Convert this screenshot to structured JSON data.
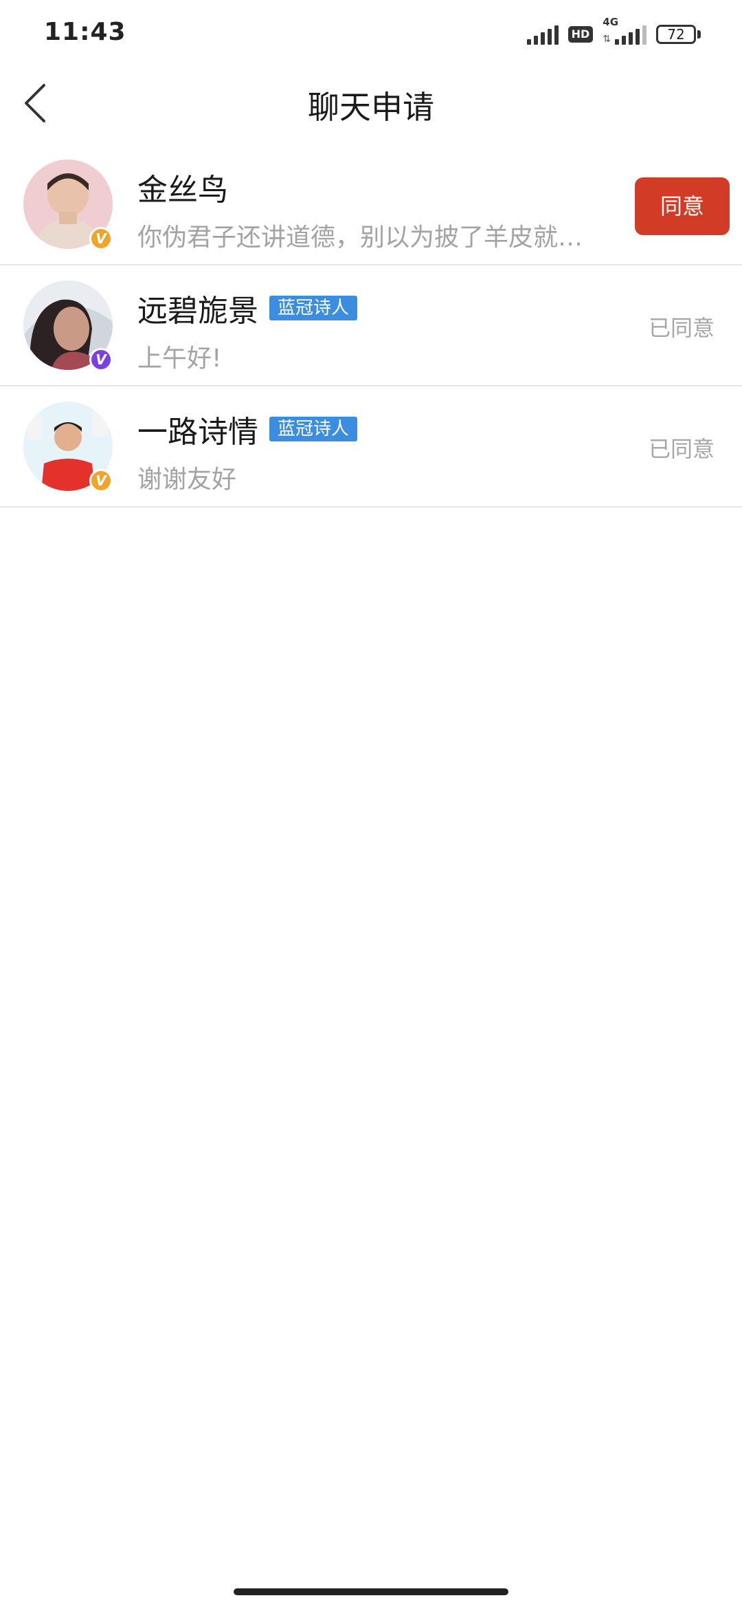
{
  "status_bar": {
    "time": "11:43",
    "hd": "HD",
    "network": "4G",
    "battery": "72"
  },
  "header": {
    "title": "聊天申请"
  },
  "requests": [
    {
      "name": "金丝鸟",
      "tag": "",
      "message": "你伪君子还讲道德，别以为披了羊皮就…",
      "action_label": "同意",
      "badge": "V",
      "badge_color": "#f0a52a"
    },
    {
      "name": "远碧旎景",
      "tag": "蓝冠诗人",
      "message": "上午好!",
      "status": "已同意",
      "badge": "V",
      "badge_color": "#7b3fe4"
    },
    {
      "name": "一路诗情",
      "tag": "蓝冠诗人",
      "message": "谢谢友好",
      "status": "已同意",
      "badge": "V",
      "badge_color": "#f0a52a"
    }
  ],
  "colors": {
    "accent": "#d23b25",
    "tag": "#3b8de0"
  }
}
